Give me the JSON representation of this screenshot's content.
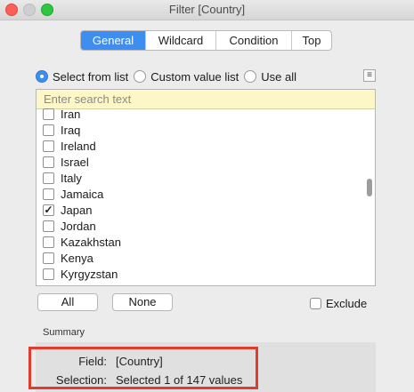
{
  "window": {
    "title": "Filter [Country]"
  },
  "tabs": [
    {
      "label": "General",
      "active": true
    },
    {
      "label": "Wildcard",
      "active": false
    },
    {
      "label": "Condition",
      "active": false
    },
    {
      "label": "Top",
      "active": false
    }
  ],
  "mode_options": [
    {
      "label": "Select from list",
      "selected": true
    },
    {
      "label": "Custom value list",
      "selected": false
    },
    {
      "label": "Use all",
      "selected": false
    }
  ],
  "search": {
    "placeholder": "Enter search text"
  },
  "list": {
    "items": [
      {
        "label": "Iran",
        "checked": false
      },
      {
        "label": "Iraq",
        "checked": false
      },
      {
        "label": "Ireland",
        "checked": false
      },
      {
        "label": "Israel",
        "checked": false
      },
      {
        "label": "Italy",
        "checked": false
      },
      {
        "label": "Jamaica",
        "checked": false
      },
      {
        "label": "Japan",
        "checked": true
      },
      {
        "label": "Jordan",
        "checked": false
      },
      {
        "label": "Kazakhstan",
        "checked": false
      },
      {
        "label": "Kenya",
        "checked": false
      },
      {
        "label": "Kyrgyzstan",
        "checked": false
      }
    ],
    "check_mark": "✓"
  },
  "buttons": {
    "all": "All",
    "none": "None"
  },
  "exclude": {
    "label": "Exclude",
    "checked": false
  },
  "summary": {
    "heading": "Summary",
    "field_key": "Field:",
    "field_value": "[Country]",
    "selection_key": "Selection:",
    "selection_value": "Selected 1 of 147 values"
  },
  "colors": {
    "accent": "#3d8ef0",
    "highlight_border": "#e03c2d",
    "search_bg": "#fdf6c6"
  }
}
